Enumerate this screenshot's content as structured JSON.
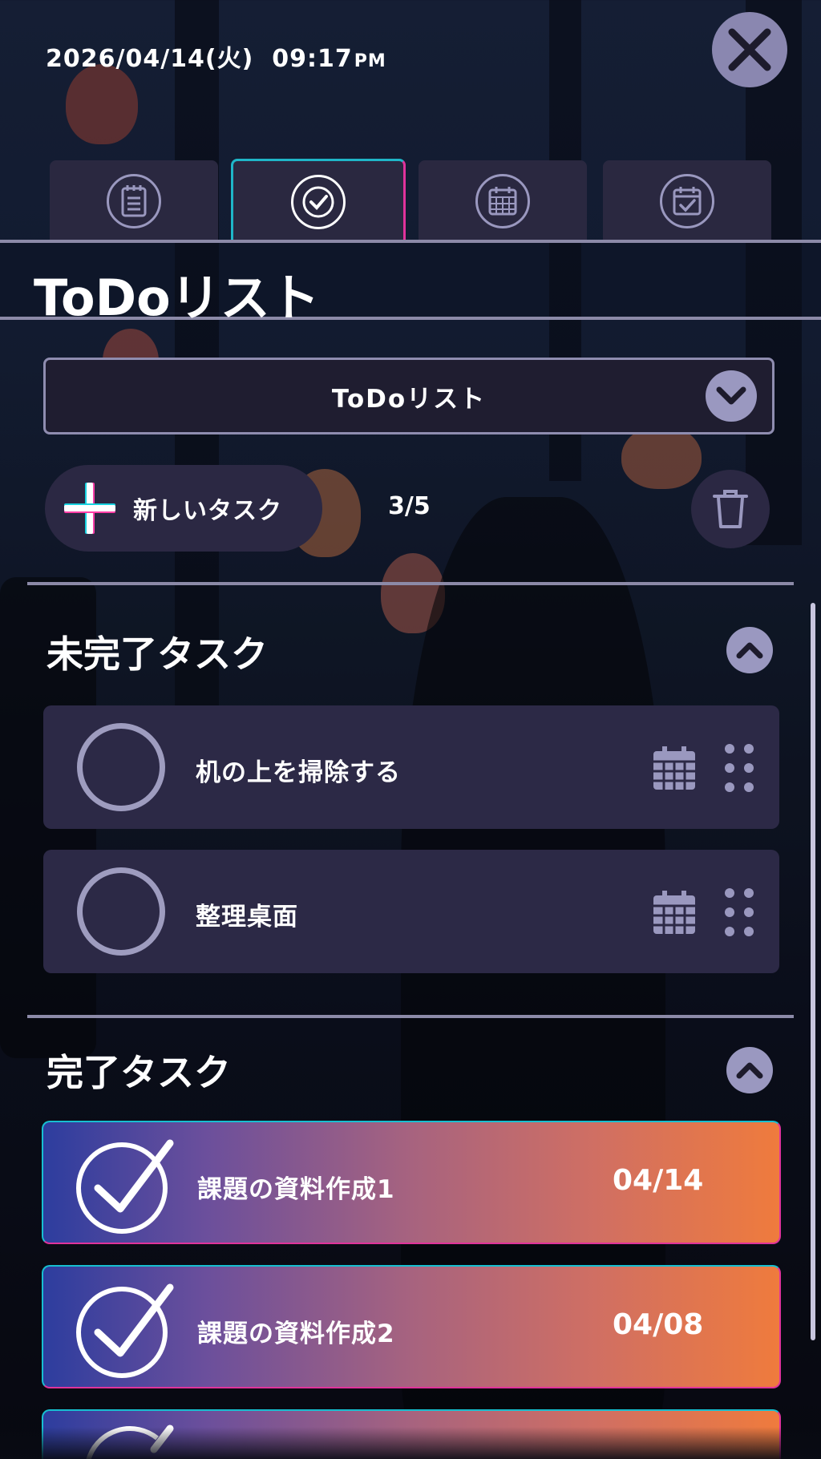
{
  "status": {
    "date": "2026/04/14(火)",
    "time": "09:17",
    "ampm": "PM"
  },
  "icons": {
    "close": "close-icon",
    "tab1": "notepad-icon",
    "tab2": "check-circle-icon",
    "tab3": "calendar-grid-icon",
    "tab4": "calendar-check-icon",
    "dropdown": "chevron-down-icon",
    "add": "plus-icon",
    "delete": "trash-icon",
    "collapse": "chevron-up-icon",
    "due": "calendar-icon",
    "drag": "drag-handle-icon",
    "done": "checkmark-icon"
  },
  "page": {
    "title": "ToDoリスト"
  },
  "list_select": {
    "selected": "ToDoリスト"
  },
  "toolbar": {
    "new_task_label": "新しいタスク",
    "count": "3/5"
  },
  "sections": {
    "incomplete_title": "未完了タスク",
    "complete_title": "完了タスク"
  },
  "incomplete_tasks": [
    {
      "name": "机の上を掃除する"
    },
    {
      "name": "整理桌面"
    }
  ],
  "complete_tasks": [
    {
      "name": "課題の資料作成1",
      "date": "04/14"
    },
    {
      "name": "課題の資料作成2",
      "date": "04/08"
    }
  ],
  "colors": {
    "accent_cyan": "#1fb6c8",
    "accent_magenta": "#e0339b",
    "card": "#2c2946",
    "icon_grey": "#9a98bf",
    "done_gradient_start": "#2d3d9e",
    "done_gradient_end": "#ef7b3d"
  }
}
